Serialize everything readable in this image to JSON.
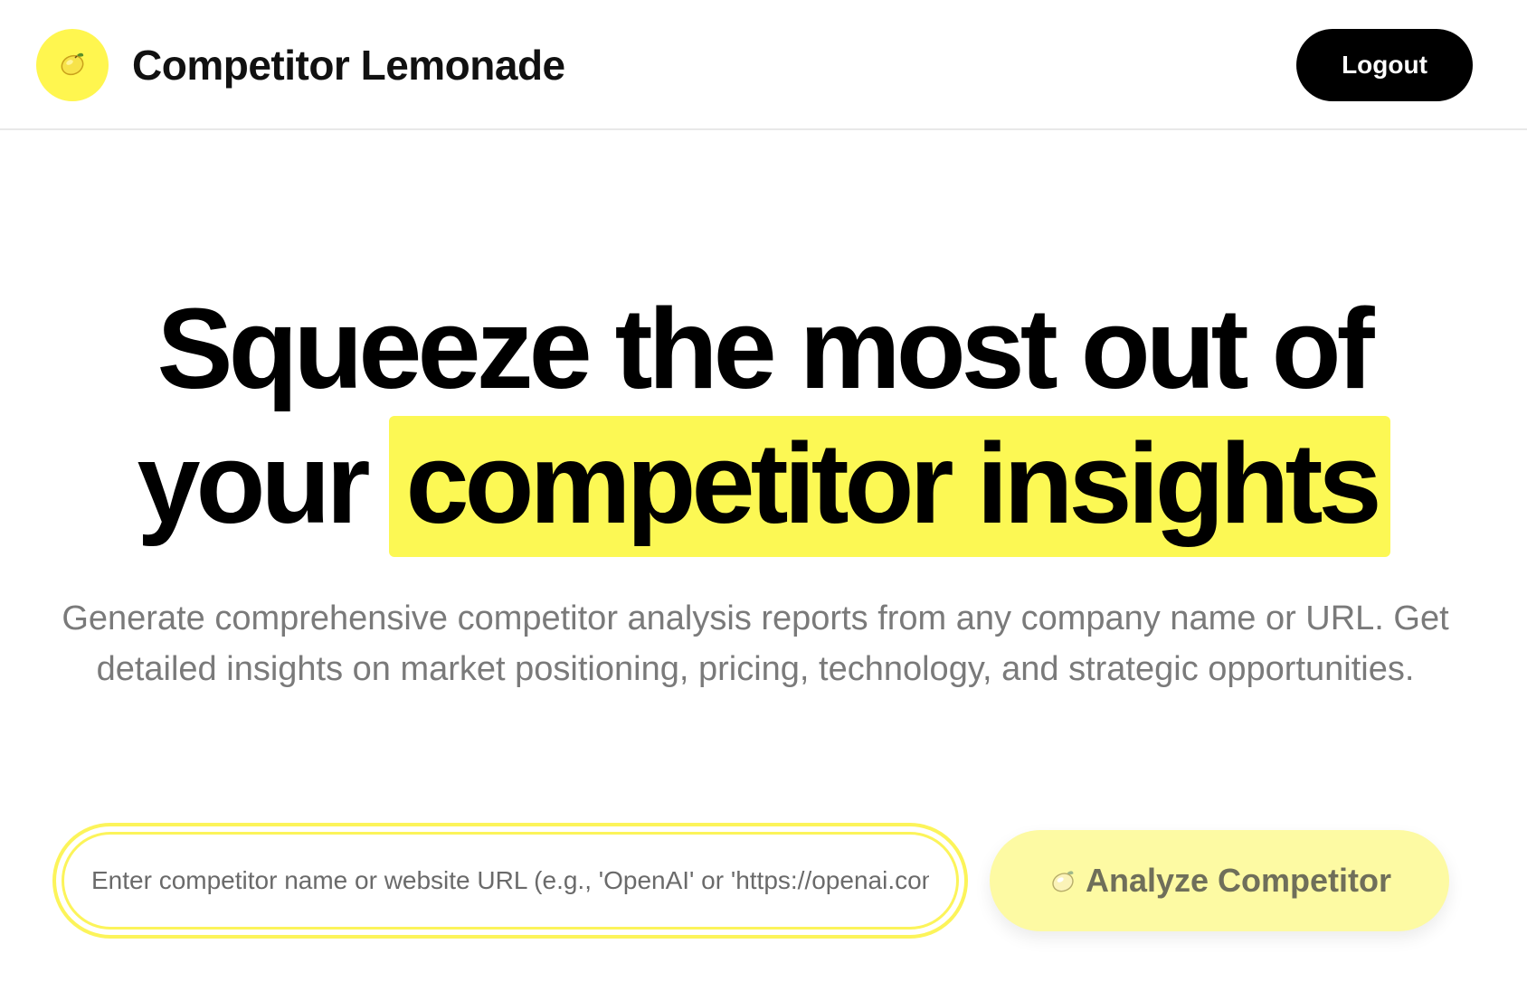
{
  "app": {
    "title": "Competitor Lemonade",
    "logo_icon": "lemon-icon"
  },
  "header": {
    "logout_label": "Logout"
  },
  "hero": {
    "headline_line1": "Squeeze the most out of",
    "headline_line2_prefix": "your",
    "headline_line2_highlight": "competitor insights",
    "subtitle": "Generate comprehensive competitor analysis reports from any company name or URL. Get detailed insights on market positioning, pricing, technology, and strategic opportunities."
  },
  "search": {
    "placeholder": "Enter competitor name or website URL (e.g., 'OpenAI' or 'https://openai.com')",
    "value": ""
  },
  "analyze_button": {
    "label": "Analyze Competitor",
    "icon": "lemon-icon"
  },
  "colors": {
    "accent_yellow": "#fcf854",
    "button_yellow": "#fdfaa3",
    "text_dark": "#000000",
    "text_muted": "#7a7a7a"
  }
}
